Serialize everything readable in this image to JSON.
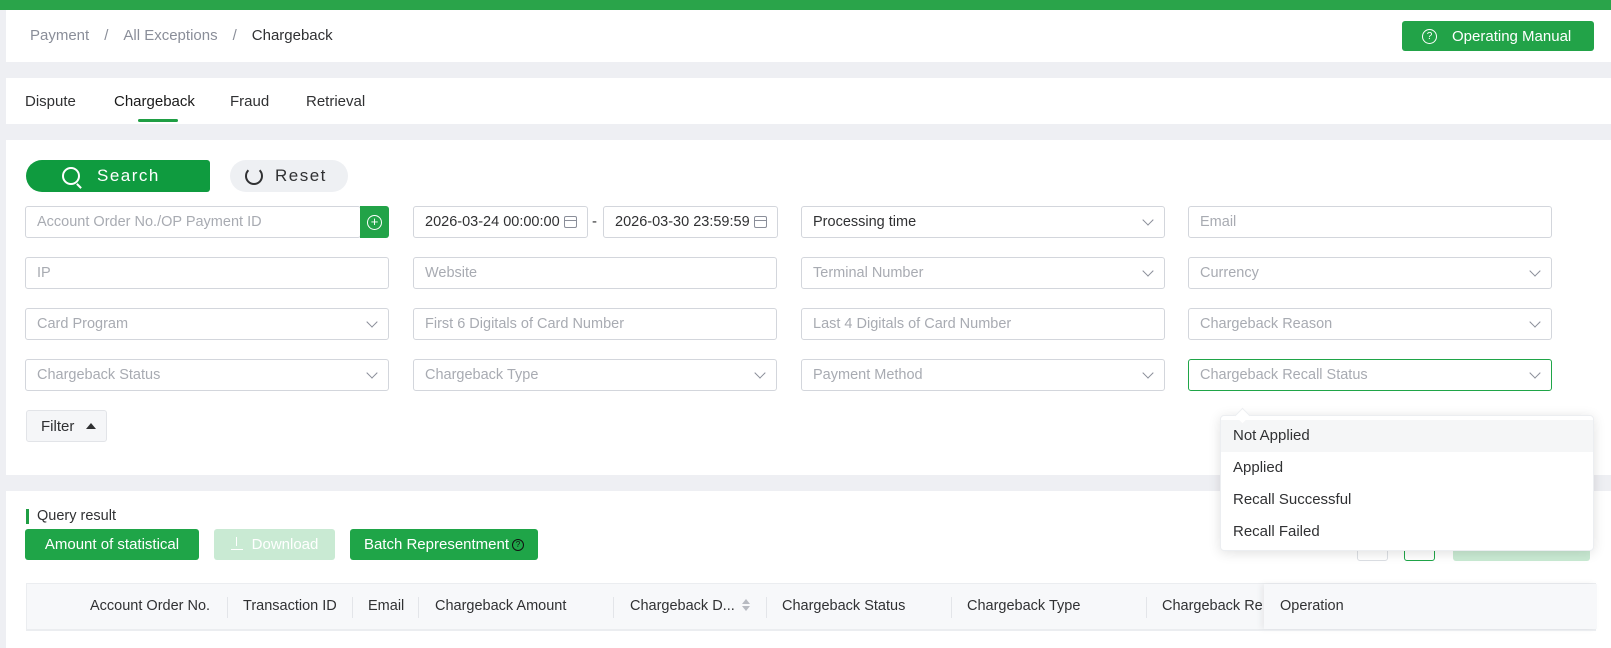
{
  "breadcrumb": {
    "items": [
      "Payment",
      "All Exceptions",
      "Chargeback"
    ],
    "separator": "/"
  },
  "header": {
    "manual_label": "Operating Manual"
  },
  "tabs": [
    {
      "label": "Dispute"
    },
    {
      "label": "Chargeback",
      "active": true
    },
    {
      "label": "Fraud"
    },
    {
      "label": "Retrieval"
    }
  ],
  "actions": {
    "search_label": "Search",
    "reset_label": "Reset"
  },
  "filters": {
    "order_placeholder": "Account Order No./OP Payment ID",
    "date_start": "2026-03-24 00:00:00",
    "date_end": "2026-03-30 23:59:59",
    "date_separator": "-",
    "time_type": "Processing time",
    "email_placeholder": "Email",
    "ip_placeholder": "IP",
    "website_placeholder": "Website",
    "terminal_placeholder": "Terminal Number",
    "currency_placeholder": "Currency",
    "card_program_placeholder": "Card Program",
    "first6_placeholder": "First 6 Digitals of Card Number",
    "last4_placeholder": "Last 4 Digitals of Card Number",
    "reason_placeholder": "Chargeback Reason",
    "status_placeholder": "Chargeback Status",
    "type_placeholder": "Chargeback Type",
    "payment_method_placeholder": "Payment Method",
    "recall_status_placeholder": "Chargeback Recall Status",
    "filter_toggle_label": "Filter"
  },
  "recall_dropdown": {
    "options": [
      "Not Applied",
      "Applied",
      "Recall Successful",
      "Recall Failed"
    ],
    "hovered_index": 0
  },
  "results": {
    "title": "Query result",
    "amount_label": "Amount of statistical",
    "download_label": "Download",
    "batch_label": "Batch Representment",
    "columns": [
      "Account Order No.",
      "Transaction ID",
      "Email",
      "Chargeback Amount",
      "Chargeback D...",
      "Chargeback Status",
      "Chargeback Type",
      "Chargeback Re",
      "Operation"
    ]
  },
  "colors": {
    "primary": "#22a348",
    "disabled_primary": "#c9ead3",
    "topbar": "#2aa44a"
  }
}
